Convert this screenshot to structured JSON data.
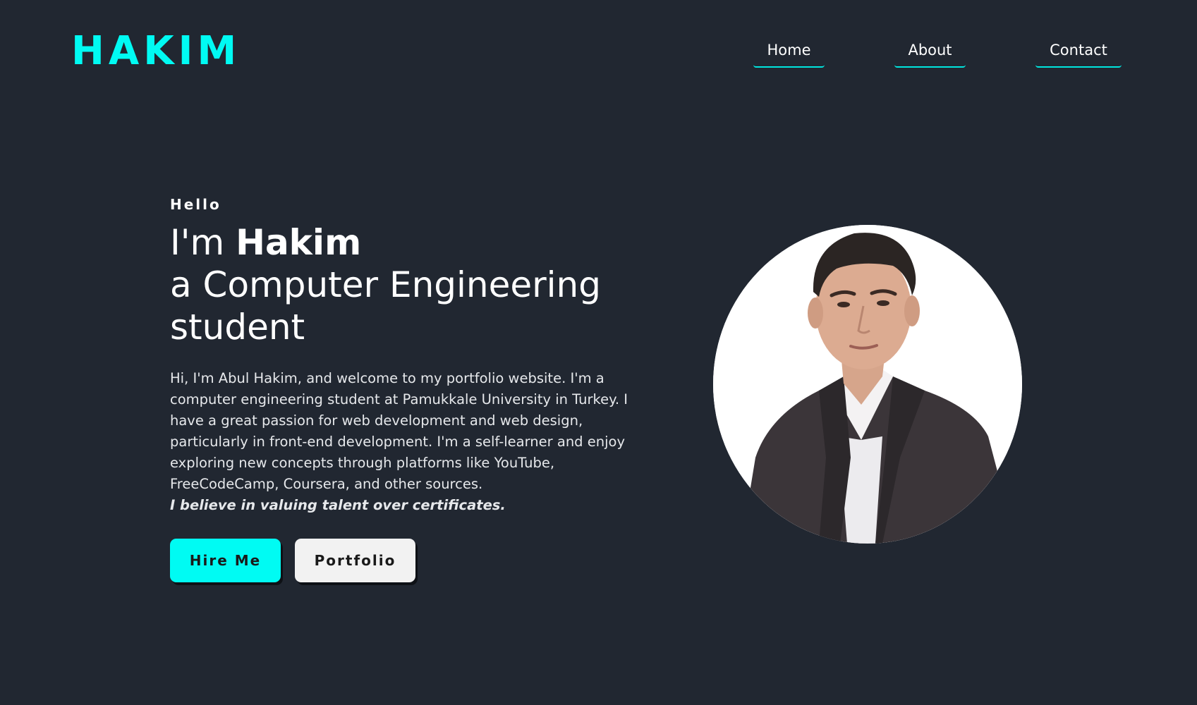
{
  "header": {
    "logo": "HAKIM",
    "nav": [
      {
        "label": "Home"
      },
      {
        "label": "About"
      },
      {
        "label": "Contact"
      }
    ]
  },
  "hero": {
    "greeting": "Hello",
    "headline_prefix": "I'm ",
    "name": "Hakim",
    "headline_rest": "a Computer Engineering student",
    "bio": "Hi, I'm Abul Hakim, and welcome to my portfolio website. I'm a computer engineering student at Pamukkale University in Turkey. I have a great passion for web development and web design, particularly in front-end development. I'm a self-learner and enjoy exploring new concepts through platforms like YouTube, FreeCodeCamp, Coursera, and other sources.",
    "motto": "I believe in valuing talent over certificates.",
    "hire_button": "Hire Me",
    "portfolio_button": "Portfolio"
  },
  "theme": {
    "background": "#212731",
    "accent": "#00fbf3",
    "secondary_button": "#f2f2f2"
  },
  "profile_photo": {
    "icon": "profile-photo"
  }
}
